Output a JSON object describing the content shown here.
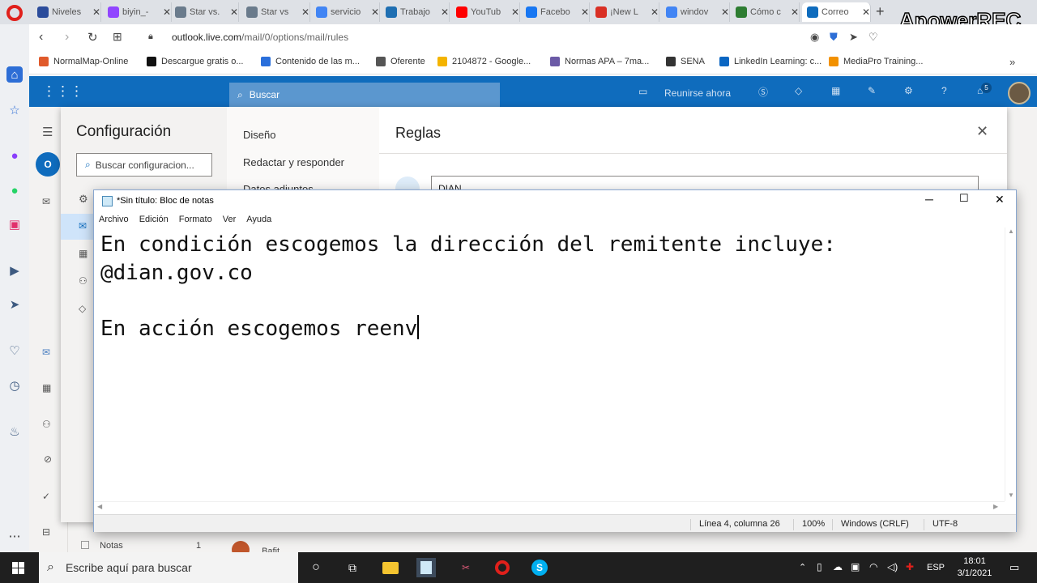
{
  "browser": {
    "tabs": [
      {
        "label": "Niveles",
        "icon": "v-icon",
        "color": "#2b4c9b"
      },
      {
        "label": "biyin_-",
        "icon": "twitch-icon",
        "color": "#9146ff"
      },
      {
        "label": "Star vs.",
        "icon": "star-icon",
        "color": "#6a7b8c"
      },
      {
        "label": "Star vs",
        "icon": "star-icon",
        "color": "#6a7b8c"
      },
      {
        "label": "servicio",
        "icon": "google-icon",
        "color": "#4285f4"
      },
      {
        "label": "Trabajo",
        "icon": "trabajo-icon",
        "color": "#1f6fb2"
      },
      {
        "label": "YouTub",
        "icon": "youtube-icon",
        "color": "#ff0000"
      },
      {
        "label": "Facebo",
        "icon": "facebook-icon",
        "color": "#1877f2"
      },
      {
        "label": "¡New L",
        "icon": "gmail-icon",
        "color": "#d93025"
      },
      {
        "label": "windov",
        "icon": "google-icon",
        "color": "#4285f4"
      },
      {
        "label": "Cómo c",
        "icon": "leaf-icon",
        "color": "#2e7d32"
      },
      {
        "label": "Correo",
        "icon": "outlook-icon",
        "color": "#0f6cbd"
      }
    ],
    "url_domain": "outlook.live.com",
    "url_path": "/mail/0/options/mail/rules",
    "watermark": "ApowerREC",
    "bookmarks": [
      {
        "label": "NormalMap-Online",
        "color": "#e05a2b"
      },
      {
        "label": "Descargue gratis o...",
        "color": "#111111"
      },
      {
        "label": "Contenido de las m...",
        "color": "#2a6fdb"
      },
      {
        "label": "Oferente",
        "color": "#555555"
      },
      {
        "label": "2104872 - Google...",
        "color": "#f4b400"
      },
      {
        "label": "Normas APA – 7ma...",
        "color": "#6b5aa6"
      },
      {
        "label": "SENA",
        "color": "#333333"
      },
      {
        "label": "LinkedIn Learning: c...",
        "color": "#0a66c2"
      },
      {
        "label": "MediaPro Training...",
        "color": "#f29100"
      }
    ]
  },
  "outlook": {
    "search_placeholder": "Buscar",
    "meet_now": "Reunirse ahora",
    "notification_count": "5",
    "settings_title": "Configuración",
    "settings_search_placeholder": "Buscar configuracion...",
    "nav_items": [
      "Diseño",
      "Redactar y responder",
      "Datos adjuntos"
    ],
    "panel_title": "Reglas",
    "rule_name_value": "DIAN",
    "folder_label": "Notas",
    "folder_count": "1",
    "bottom_sender": "Bafit"
  },
  "notepad": {
    "title": "*Sin título: Bloc de notas",
    "menu": [
      "Archivo",
      "Edición",
      "Formato",
      "Ver",
      "Ayuda"
    ],
    "lines": [
      "En condición escogemos la dirección del remitente incluye:",
      "@dian.gov.co",
      "",
      "En acción escogemos reenv"
    ],
    "status": {
      "position": "Línea 4, columna 26",
      "zoom": "100%",
      "line_ending": "Windows (CRLF)",
      "encoding": "UTF-8"
    }
  },
  "taskbar": {
    "search_placeholder": "Escribe aquí para buscar",
    "language": "ESP",
    "time": "18:01",
    "date": "3/1/2021"
  }
}
